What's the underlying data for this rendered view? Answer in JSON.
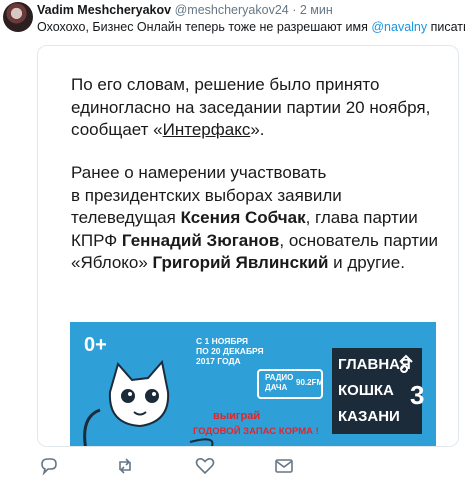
{
  "tweet": {
    "author_name": "Vadim Meshcheryakov",
    "author_handle": "@meshcheryakov24",
    "separator": "·",
    "time": "2 мин",
    "text_before": "Охохохо, Бизнес Онлайн теперь тоже не разрешают имя ",
    "mention": "@navalny",
    "text_after": " писать?)"
  },
  "card": {
    "p1_a": "По его словам, решение было принято",
    "p1_b": "единогласно на заседании партии 20 ноября,",
    "p1_c_pre": "сообщает «",
    "p1_c_link": "Интерфакс",
    "p1_c_post": "».",
    "p2_a": "Ранее о намерении участвовать",
    "p2_b": "в президентских выборах заявили",
    "p2_c_pre": "телеведущая ",
    "p2_c_bold": "Ксения Собчак",
    "p2_c_post": ", глава партии",
    "p2_d_pre": "КПРФ ",
    "p2_d_bold": "Геннадий Зюганов",
    "p2_d_post": ", основатель партии",
    "p2_e_pre": "«Яблоко» ",
    "p2_e_bold": "Григорий Явлинский",
    "p2_e_post": " и другие."
  },
  "banner": {
    "age": "0+",
    "dates_1": "С 1 НОЯБРЯ",
    "dates_2": "ПО 20 ДЕКАБРЯ",
    "dates_3": "2017 ГОДА",
    "radio_1": "РАДИО",
    "radio_2": "ДАЧА",
    "radio_freq": "90.2FM",
    "promo_1": "выиграй",
    "promo_2": "ГОДОВОЙ ЗАПАС КОРМА !",
    "title_1": "ГЛАВНАЯ",
    "title_2": "КОШКА",
    "title_3": "КАЗАНИ",
    "title_num": "3",
    "colors": {
      "background": "#2f9fd8",
      "promo": "#e0262a",
      "title_bg": "#1c2b3a"
    }
  },
  "actions": [
    "reply-icon",
    "retweet-icon",
    "like-icon",
    "message-icon"
  ]
}
